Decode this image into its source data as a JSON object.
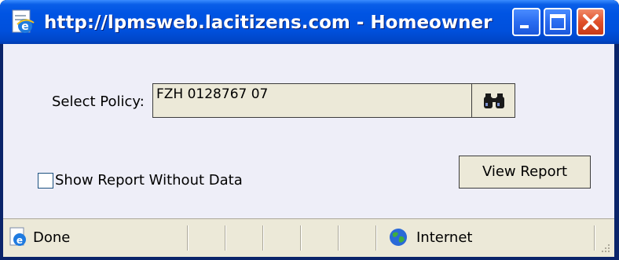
{
  "window": {
    "title": "http://lpmsweb.lacitizens.com - Homeowner ...",
    "title_icon": "ie-page-icon",
    "controls": [
      "minimize-icon",
      "maximize-icon",
      "close-icon"
    ]
  },
  "form": {
    "select_policy_label": "Select Policy:",
    "policy_value": "FZH 0128767 07",
    "lookup_icon": "binoculars-icon",
    "show_without_data_label": "Show Report Without Data",
    "show_without_data_checked": false,
    "view_report_label": "View Report"
  },
  "statusbar": {
    "status_icon": "ie-page-icon",
    "status_text": "Done",
    "zone_icon": "globe-icon",
    "zone_text": "Internet"
  },
  "colors": {
    "titlebar": "#0054e3",
    "client_bg": "#eeeef8",
    "control_bg": "#ece9d8",
    "close_button": "#e0502a"
  }
}
